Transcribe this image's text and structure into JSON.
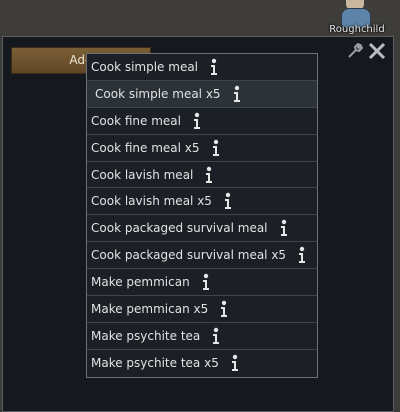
{
  "pawn": {
    "name": "Roughchild"
  },
  "window": {
    "add_button_label": "Add"
  },
  "menu": {
    "items": [
      {
        "label": "Cook simple meal"
      },
      {
        "label": "Cook simple meal x5"
      },
      {
        "label": "Cook fine meal"
      },
      {
        "label": "Cook fine meal x5"
      },
      {
        "label": "Cook lavish meal"
      },
      {
        "label": "Cook lavish meal x5"
      },
      {
        "label": "Cook packaged survival meal"
      },
      {
        "label": "Cook packaged survival meal x5"
      },
      {
        "label": "Make pemmican"
      },
      {
        "label": "Make pemmican x5"
      },
      {
        "label": "Make psychite tea"
      },
      {
        "label": "Make psychite tea x5"
      }
    ]
  },
  "icons": {
    "info": "info-icon",
    "close": "close-icon",
    "wrench": "wrench-icon"
  },
  "colors": {
    "window_bg": "#15191e",
    "menu_bg": "#1c2026",
    "hover_bg": "#2b3238",
    "add_button": "#6d5230"
  }
}
